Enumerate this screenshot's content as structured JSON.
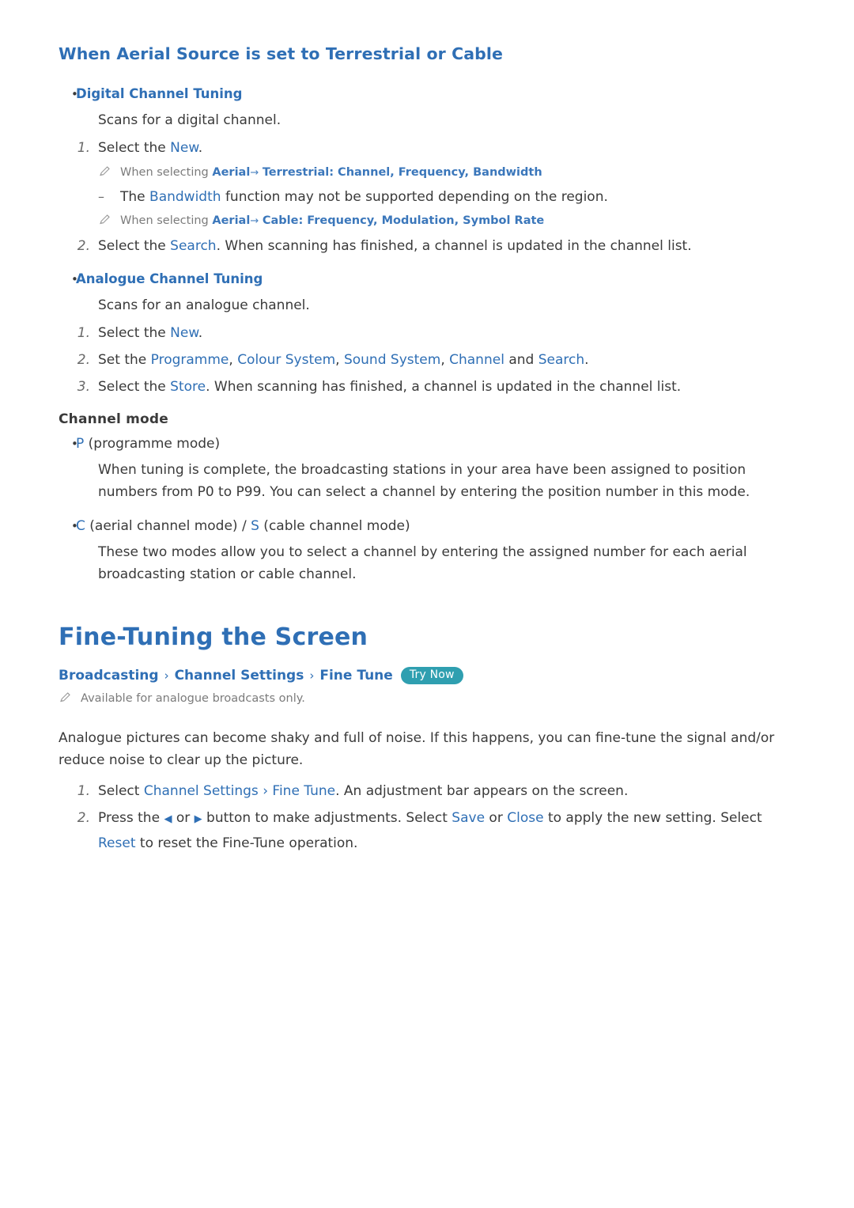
{
  "section": {
    "title": "When Aerial Source is set to Terrestrial or Cable"
  },
  "digital": {
    "heading": "Digital Channel Tuning",
    "description": "Scans for a digital channel.",
    "step1_prefix": "Select the ",
    "step1_link": "New",
    "step1_suffix": ".",
    "note1_prefix": "When selecting ",
    "note1_aerial": "Aerial",
    "note1_arrow": "→",
    "note1_rest": "Terrestrial: Channel, Frequency, Bandwidth",
    "dash_prefix": "The ",
    "dash_link": "Bandwidth",
    "dash_suffix": " function may not be supported depending on the region.",
    "note2_prefix": "When selecting ",
    "note2_aerial": "Aerial",
    "note2_arrow": "→",
    "note2_rest": "Cable: Frequency, Modulation, Symbol Rate",
    "step2_prefix": "Select the ",
    "step2_link": "Search",
    "step2_suffix": ". When scanning has finished, a channel is updated in the channel list."
  },
  "analogue": {
    "heading": "Analogue Channel Tuning",
    "description": "Scans for an analogue channel.",
    "step1_prefix": "Select the ",
    "step1_link": "New",
    "step1_suffix": ".",
    "step2_prefix": "Set the ",
    "step2_l1": "Programme",
    "step2_l2": "Colour System",
    "step2_l3": "Sound System",
    "step2_l4": "Channel",
    "step2_and": " and ",
    "step2_l5": "Search",
    "step2_suffix": ".",
    "step3_prefix": "Select the ",
    "step3_link": "Store",
    "step3_suffix": ". When scanning has finished, a channel is updated in the channel list."
  },
  "channel_mode": {
    "heading": "Channel mode",
    "item1_key": "P",
    "item1_rest": " (programme mode)",
    "item1_para": "When tuning is complete, the broadcasting stations in your area have been assigned to position numbers from P0 to P99. You can select a channel by entering the position number in this mode.",
    "item2_key1": "C",
    "item2_mid": " (aerial channel mode) / ",
    "item2_key2": "S",
    "item2_rest": " (cable channel mode)",
    "item2_para": "These two modes allow you to select a channel by entering the assigned number for each aerial broadcasting station or cable channel."
  },
  "fine_tune": {
    "title": "Fine-Tuning the Screen",
    "breadcrumb": [
      "Broadcasting",
      "Channel Settings",
      "Fine Tune"
    ],
    "breadcrumb_sep": "›",
    "try_now": "Try Now",
    "note": "Available for analogue broadcasts only.",
    "intro": "Analogue pictures can become shaky and full of noise. If this happens, you can fine-tune the signal and/or reduce noise to clear up the picture.",
    "step1_prefix": "Select ",
    "step1_l1": "Channel Settings",
    "step1_sep": " › ",
    "step1_l2": "Fine Tune",
    "step1_suffix": ". An adjustment bar appears on the screen.",
    "step2_prefix": "Press the ",
    "step2_left_glyph": "◀",
    "step2_or": " or ",
    "step2_right_glyph": "▶",
    "step2_mid": " button to make adjustments. Select ",
    "step2_l1": "Save",
    "step2_or2": " or ",
    "step2_l2": "Close",
    "step2_mid2": " to apply the new setting. Select ",
    "step2_l3": "Reset",
    "step2_suffix": " to reset the Fine-Tune operation."
  },
  "numbers": {
    "n1": "1.",
    "n2": "2.",
    "n3": "3."
  },
  "colors": {
    "link": "#2f6fb5",
    "body": "#3a3a3a",
    "note": "#7b7b7b",
    "badge": "#2f9fb0"
  }
}
